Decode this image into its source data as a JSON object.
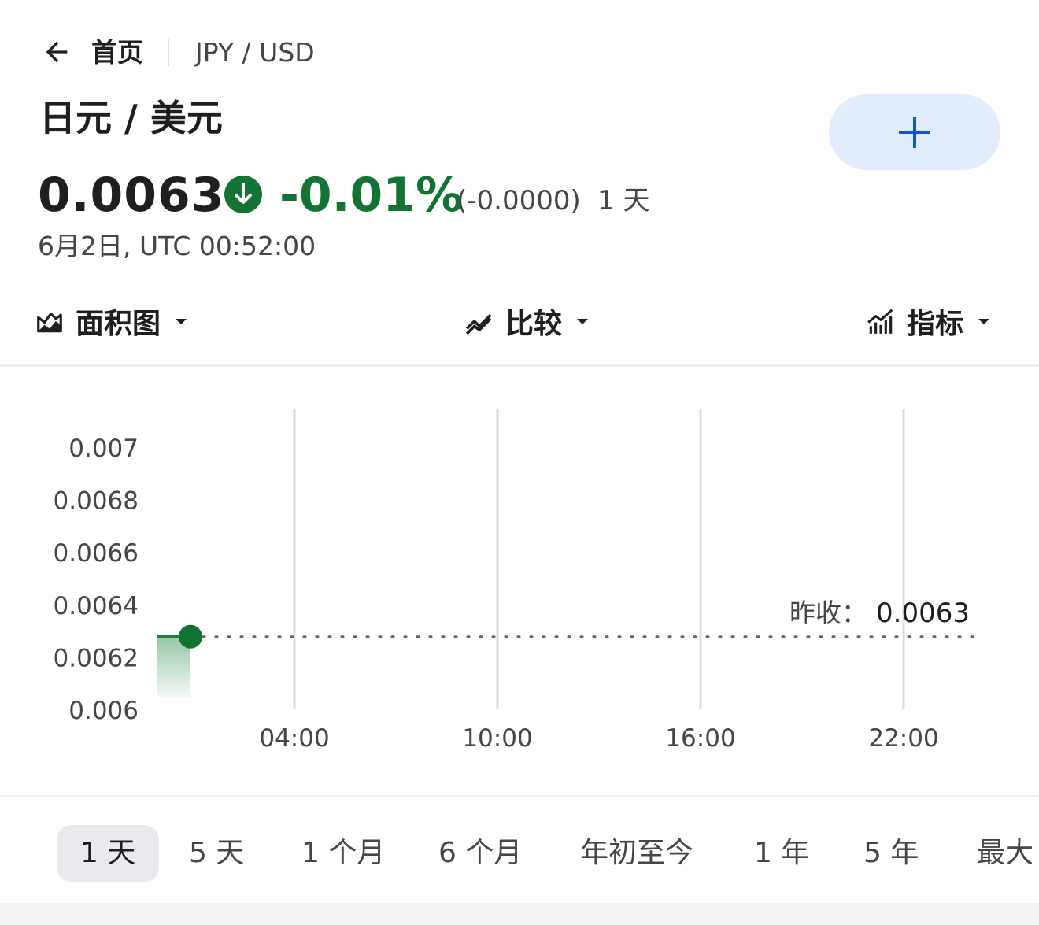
{
  "breadcrumb": {
    "home": "首页",
    "symbol": "JPY / USD"
  },
  "title": "日元 / 美元",
  "quote": {
    "price": "0.0063",
    "change_percent": "-0.01%",
    "change_abs": "(-0.0000)",
    "period": "1 天",
    "timestamp": "6月2日, UTC 00:52:00",
    "direction": "down"
  },
  "toolbar": {
    "chart_type": "面积图",
    "compare": "比较",
    "indicators": "指标"
  },
  "prev_close": {
    "label": "昨收：",
    "value": "0.0063"
  },
  "range_tabs": [
    "1 天",
    "5 天",
    "1 个月",
    "6 个月",
    "年初至今",
    "1 年",
    "5 年",
    "最大"
  ],
  "selected_range": "1 天",
  "colors": {
    "positive": "#137333",
    "line": "#188038",
    "accent": "#0b57d0",
    "add_bg": "#e3ecfd"
  },
  "chart_data": {
    "type": "area",
    "x_tick_labels": [
      "04:00",
      "10:00",
      "16:00",
      "22:00"
    ],
    "y_tick_labels": [
      "0.007",
      "0.0068",
      "0.0066",
      "0.0064",
      "0.0062",
      "0.006"
    ],
    "ylim": [
      0.006,
      0.007
    ],
    "xlim": [
      "00:00",
      "24:00"
    ],
    "series": [
      {
        "x": [
          "00:00",
          "00:52"
        ],
        "y": [
          0.00628,
          0.00628
        ]
      }
    ],
    "reference_line": {
      "label": "昨收：",
      "value": 0.00628
    },
    "grid": "vertical"
  }
}
